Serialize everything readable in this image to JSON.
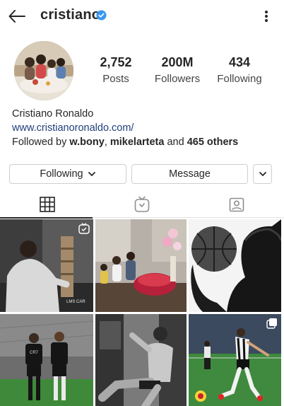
{
  "header": {
    "username": "cristiano",
    "icons": {
      "back": "arrow-left-icon",
      "verified": "verified-badge-icon",
      "more": "more-vertical-icon"
    },
    "verified_color": "#3897f0"
  },
  "profile": {
    "posts_count": "2,752",
    "posts_label": "Posts",
    "followers_count": "200M",
    "followers_label": "Followers",
    "following_count": "434",
    "following_label": "Following",
    "full_name": "Cristiano Ronaldo",
    "website": "www.cristianoronaldo.com/",
    "followed_by_prefix": "Followed by ",
    "followed_by_user1": "w.bony",
    "followed_by_sep": ", ",
    "followed_by_user2": "mikelarteta",
    "followed_by_and": " and ",
    "followed_by_others": "465 others"
  },
  "actions": {
    "following_label": "Following",
    "message_label": "Message",
    "icons": {
      "following_chevron": "chevron-down-icon",
      "suggest": "chevron-down-icon"
    }
  },
  "tabs": [
    {
      "name": "grid",
      "icon": "grid-icon",
      "active": true
    },
    {
      "name": "igtv",
      "icon": "tv-icon",
      "active": false
    },
    {
      "name": "tagged",
      "icon": "tagged-person-icon",
      "active": false
    }
  ],
  "posts": [
    {
      "id": "post-1",
      "badge": "igtv-icon",
      "watermark": "LMS CAR"
    },
    {
      "id": "post-2",
      "badge": ""
    },
    {
      "id": "post-3",
      "badge": ""
    },
    {
      "id": "post-4",
      "badge": "",
      "shirt_text": "CR7"
    },
    {
      "id": "post-5",
      "badge": ""
    },
    {
      "id": "post-6",
      "badge": "carousel-icon"
    }
  ],
  "colors": {
    "link": "#1f3f7a",
    "text": "#262626",
    "border": "#cfcfcf"
  }
}
